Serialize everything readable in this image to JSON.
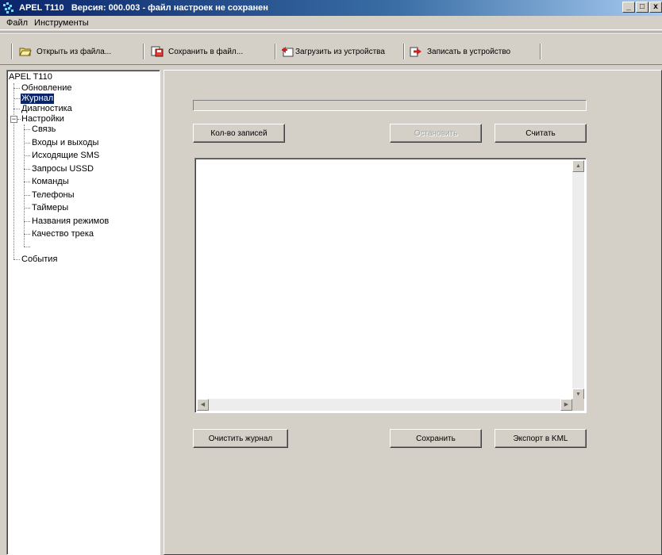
{
  "window": {
    "app_name": "APEL T110",
    "title_rest": "Версия: 000.003 - файл настроек не сохранен"
  },
  "menu": [
    "Файл",
    "Инструменты"
  ],
  "toolbar": {
    "open_from_file": "Открыть из файла...",
    "save_to_file": "Сохранить в файл...",
    "load_from_device": "Загрузить из устройства",
    "write_to_device": "Записать в устройство"
  },
  "tree": {
    "root": "APEL T110",
    "items": {
      "update": "Обновление",
      "journal": "Журнал",
      "diagnostics": "Диагностика",
      "settings": "Настройки",
      "events": "События"
    },
    "settings_children": [
      "Связь",
      "Входы и выходы",
      "Исходящие SMS",
      "Запросы USSD",
      "Команды",
      "Телефоны",
      "Таймеры",
      "Названия режимов",
      "Качество трека"
    ],
    "selected": "Журнал"
  },
  "journal": {
    "progress": 0,
    "record_count_button": "Кол-во записей",
    "stop_button": "Остановить",
    "read_button": "Считать",
    "clear_button": "Очистить журнал",
    "save_button": "Сохранить",
    "export_kml_button": "Экспорт в KML"
  },
  "colors": {
    "title_gradient_start": "#0a246a",
    "selection": "#0a246a",
    "face": "#d4d0c8"
  }
}
